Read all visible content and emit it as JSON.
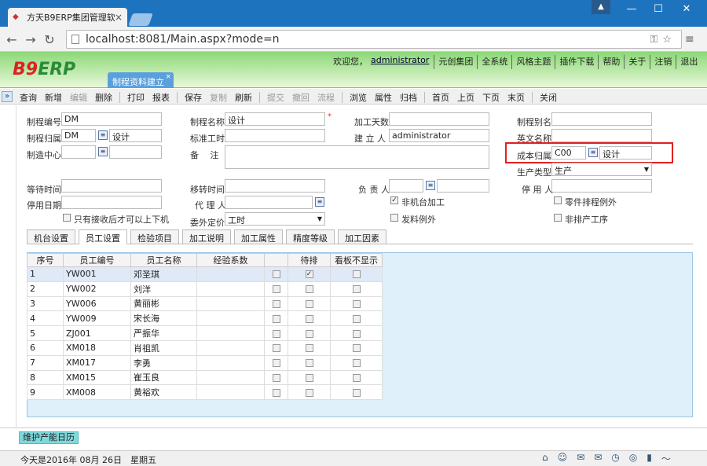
{
  "browser": {
    "tab_title": "方天B9ERP集团管理软件",
    "url": "localhost:8081/Main.aspx?mode=n"
  },
  "app": {
    "logo_main": "B9",
    "logo_sub": "ERP",
    "greeting": "欢迎您，",
    "user": "administrator",
    "top_menu": [
      "元创集团",
      "全系统",
      "风格主题",
      "插件下载",
      "帮助",
      "关于",
      "注销",
      "退出"
    ],
    "active_tab": "制程资料建立"
  },
  "toolbar": {
    "groups": [
      [
        {
          "label": "查询",
          "enabled": true
        },
        {
          "label": "新增",
          "enabled": true
        },
        {
          "label": "编辑",
          "enabled": false
        },
        {
          "label": "删除",
          "enabled": true
        }
      ],
      [
        {
          "label": "打印",
          "enabled": true
        },
        {
          "label": "报表",
          "enabled": true
        }
      ],
      [
        {
          "label": "保存",
          "enabled": true
        },
        {
          "label": "复制",
          "enabled": false
        },
        {
          "label": "刷新",
          "enabled": true
        }
      ],
      [
        {
          "label": "提交",
          "enabled": false
        },
        {
          "label": "撤回",
          "enabled": false
        },
        {
          "label": "流程",
          "enabled": false
        }
      ],
      [
        {
          "label": "浏览",
          "enabled": true
        },
        {
          "label": "属性",
          "enabled": true
        },
        {
          "label": "归档",
          "enabled": true
        }
      ],
      [
        {
          "label": "首页",
          "enabled": true
        },
        {
          "label": "上页",
          "enabled": true
        },
        {
          "label": "下页",
          "enabled": true
        },
        {
          "label": "末页",
          "enabled": true
        }
      ],
      [
        {
          "label": "关闭",
          "enabled": true
        }
      ]
    ]
  },
  "form": {
    "code_label": "制程编号",
    "code_value": "DM",
    "name_label": "制程名称",
    "name_value": "设计",
    "days_label": "加工天数",
    "days_value": "",
    "alias_label": "制程别名",
    "alias_value": "",
    "belong_label": "制程归属",
    "belong_code": "DM",
    "belong_name": "设计",
    "std_time_label": "标准工时",
    "std_time_value": "",
    "creator_label": "建 立 人",
    "creator_value": "administrator",
    "en_name_label": "英文名称",
    "en_name_value": "",
    "center_label": "制造中心",
    "center_code": "",
    "center_name": "",
    "remark_label": "备　 注",
    "remark_value": "",
    "cost_label": "成本归属",
    "cost_code": "C00",
    "cost_name": "设计",
    "prod_type_label": "生产类型",
    "prod_type_value": "生产",
    "wait_label": "等待时间",
    "wait_value": "",
    "move_label": "移转时间",
    "move_value": "",
    "owner_label": "负 责 人",
    "owner_code": "",
    "owner_name": "",
    "disabler_label": "停 用 人",
    "disabler_value": "",
    "disable_date_label": "停用日期",
    "disable_date_value": "",
    "agent_label": "代 理 人",
    "agent_value": "",
    "non_machine_label": "非机台加工",
    "part_sched_label": "零件排程例外",
    "only_after_label": "只有接收后才可以上下机",
    "outsrc_label": "委外定价",
    "outsrc_value": "工时",
    "issue_exc_label": "发料例外",
    "non_prod_label": "非排产工序"
  },
  "detail_tabs": [
    "机台设置",
    "员工设置",
    "检验项目",
    "加工说明",
    "加工属性",
    "精度等级",
    "加工因素"
  ],
  "active_detail_tab": "员工设置",
  "grid": {
    "headers": [
      "序号",
      "员工编号",
      "员工名称",
      "经验系数",
      "",
      "待排",
      "看板不显示"
    ],
    "rows": [
      {
        "no": "1",
        "code": "YW001",
        "name": "邓圣琪",
        "coef": "",
        "c1": false,
        "pending": true,
        "hide": false
      },
      {
        "no": "2",
        "code": "YW002",
        "name": "刘洋",
        "coef": "",
        "c1": false,
        "pending": false,
        "hide": false
      },
      {
        "no": "3",
        "code": "YW006",
        "name": "黄丽彬",
        "coef": "",
        "c1": false,
        "pending": false,
        "hide": false
      },
      {
        "no": "4",
        "code": "YW009",
        "name": "宋长海",
        "coef": "",
        "c1": false,
        "pending": false,
        "hide": false
      },
      {
        "no": "5",
        "code": "ZJ001",
        "name": "严振华",
        "coef": "",
        "c1": false,
        "pending": false,
        "hide": false
      },
      {
        "no": "6",
        "code": "XM018",
        "name": "肖祖凯",
        "coef": "",
        "c1": false,
        "pending": false,
        "hide": false
      },
      {
        "no": "7",
        "code": "XM017",
        "name": "李勇",
        "coef": "",
        "c1": false,
        "pending": false,
        "hide": false
      },
      {
        "no": "8",
        "code": "XM015",
        "name": "崔玉良",
        "coef": "",
        "c1": false,
        "pending": false,
        "hide": false
      },
      {
        "no": "9",
        "code": "XM008",
        "name": "黄裕欢",
        "coef": "",
        "c1": false,
        "pending": false,
        "hide": false
      }
    ]
  },
  "footer": {
    "maintain_button": "维护产能日历",
    "status": "今天是2016年 08月 26日　星期五"
  }
}
